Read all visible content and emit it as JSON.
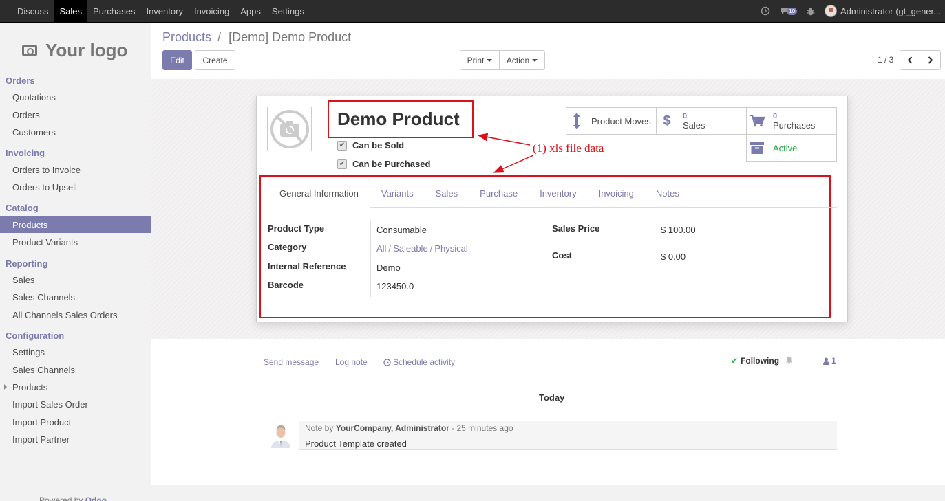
{
  "topbar": {
    "menu": [
      "Discuss",
      "Sales",
      "Purchases",
      "Inventory",
      "Invoicing",
      "Apps",
      "Settings"
    ],
    "active": "Sales",
    "message_count": "10",
    "user": "Administrator (gt_gener..."
  },
  "sidebar": {
    "logo_text": "Your logo",
    "sections": {
      "orders": "Orders",
      "invoicing": "Invoicing",
      "catalog": "Catalog",
      "reporting": "Reporting",
      "configuration": "Configuration"
    },
    "items": {
      "quotations": "Quotations",
      "orders": "Orders",
      "customers": "Customers",
      "orders_to_invoice": "Orders to Invoice",
      "orders_to_upsell": "Orders to Upsell",
      "products": "Products",
      "product_variants": "Product Variants",
      "sales": "Sales",
      "sales_channels": "Sales Channels",
      "all_channels_sales_orders": "All Channels Sales Orders",
      "settings": "Settings",
      "config_sales_channels": "Sales Channels",
      "config_products": "Products",
      "import_sales_order": "Import Sales Order",
      "import_product": "Import Product",
      "import_partner": "Import Partner"
    },
    "powered_by": "Powered by",
    "powered_by_brand": "Odoo"
  },
  "control_panel": {
    "breadcrumb_parent": "Products",
    "breadcrumb_separator": "/",
    "breadcrumb_current": "[Demo] Demo Product",
    "edit_label": "Edit",
    "create_label": "Create",
    "print_label": "Print",
    "action_label": "Action",
    "pager": "1 / 3"
  },
  "form": {
    "name": "Demo Product",
    "can_be_sold_label": "Can be Sold",
    "can_be_sold": true,
    "can_be_purchased_label": "Can be Purchased",
    "can_be_purchased": true,
    "smart_buttons": {
      "product_moves": "Product Moves",
      "sales_count": "0",
      "sales_label": "Sales",
      "purchases_count": "0",
      "purchases_label": "Purchases",
      "active_label": "Active"
    },
    "annotation": "(1) xls file data",
    "tabs": [
      "General Information",
      "Variants",
      "Sales",
      "Purchase",
      "Inventory",
      "Invoicing",
      "Notes"
    ],
    "active_tab": "General Information",
    "fields": {
      "product_type_label": "Product Type",
      "product_type": "Consumable",
      "category_label": "Category",
      "category_parts": [
        "All",
        "Saleable",
        "Physical"
      ],
      "category_sep": "/",
      "internal_reference_label": "Internal Reference",
      "internal_reference": "Demo",
      "barcode_label": "Barcode",
      "barcode": "123450.0",
      "sales_price_label": "Sales Price",
      "sales_price": "$ 100.00",
      "cost_label": "Cost",
      "cost": "$ 0.00"
    }
  },
  "chatter": {
    "send_message": "Send message",
    "log_note": "Log note",
    "schedule_activity": "Schedule activity",
    "following": "Following",
    "followers_count": "1",
    "today": "Today",
    "message": {
      "prefix": "Note by",
      "author": "YourCompany, Administrator",
      "time": "- 25 minutes ago",
      "body": "Product Template created"
    }
  },
  "colors": {
    "brand": "#7c7bad",
    "annotation_red": "#d9131b",
    "topbar": "#2c2c2c",
    "active_green": "#28a745"
  }
}
